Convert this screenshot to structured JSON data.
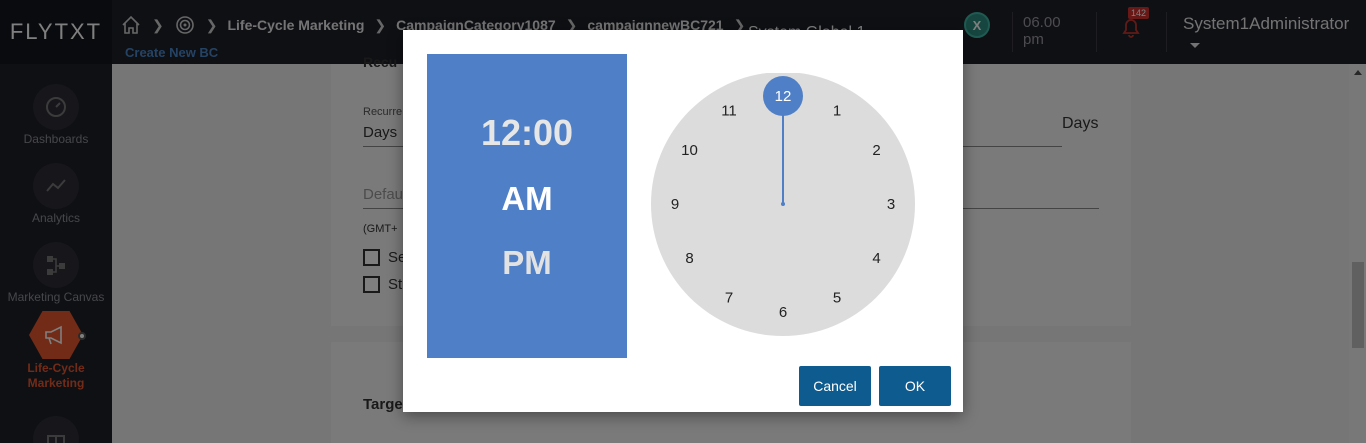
{
  "header": {
    "logo": "FLYTXT",
    "breadcrumbs": [
      "Life-Cycle Marketing",
      "CampaignCategory1087",
      "campaignnewBC721"
    ],
    "subtitle": "Create New BC",
    "title_partial": "System Global 1",
    "x_badge": "X",
    "time_line1": "06.00",
    "time_line2": "pm",
    "notification_count": "142",
    "user": "System1Administrator"
  },
  "sidebar": {
    "items": [
      {
        "label": "Dashboards",
        "icon": "gauge-icon"
      },
      {
        "label": "Analytics",
        "icon": "line-chart-icon"
      },
      {
        "label": "Marketing Canvas",
        "icon": "flow-icon"
      },
      {
        "label": "Life-Cycle Marketing",
        "icon": "megaphone-icon",
        "active": true
      },
      {
        "label": "",
        "icon": "gift-icon"
      }
    ]
  },
  "form": {
    "section_partial": "Recu",
    "recurrence_label": "Recurre",
    "recurrence_value": "Days",
    "days_suffix": "Days",
    "default_placeholder": "Defau",
    "timezone_partial": "(GMT+",
    "checkbox1_partial": "Se",
    "checkbox2_partial": "St",
    "target_partial": "Targe"
  },
  "time_picker": {
    "time": "12:00",
    "am_label": "AM",
    "pm_label": "PM",
    "selected_period": "AM",
    "selected_hour": 12,
    "clock_numbers": [
      "12",
      "1",
      "2",
      "3",
      "4",
      "5",
      "6",
      "7",
      "8",
      "9",
      "10",
      "11"
    ],
    "cancel_label": "Cancel",
    "ok_label": "OK",
    "colors": {
      "panel": "#4f7fc6",
      "face": "#dcdcdc",
      "hand": "#4f7fc6",
      "button": "#0e5c8f"
    }
  }
}
